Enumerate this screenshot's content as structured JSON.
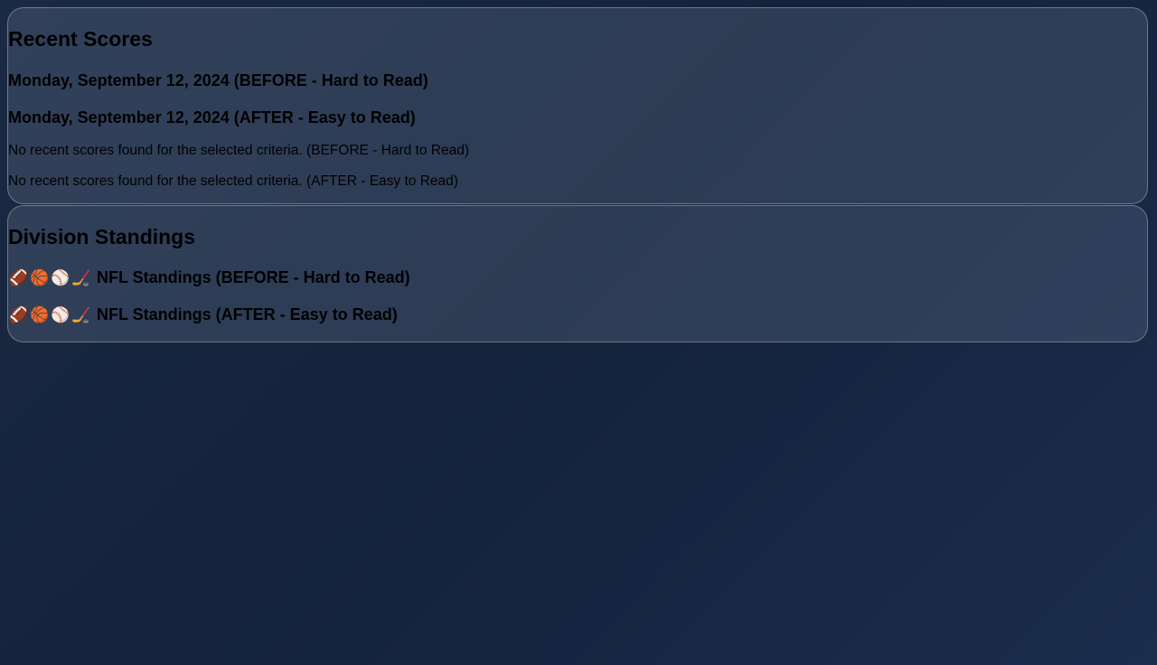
{
  "recent_scores": {
    "title": "Recent Scores",
    "date_before": "Monday, September 12, 2024 (BEFORE - Hard to Read)",
    "date_after": "Monday, September 12, 2024 (AFTER - Easy to Read)",
    "empty_before": "No recent scores found for the selected criteria. (BEFORE - Hard to Read)",
    "empty_after": "No recent scores found for the selected criteria. (AFTER - Easy to Read)"
  },
  "division_standings": {
    "title": "Division Standings",
    "icons": [
      "football-icon",
      "basketball-icon",
      "baseball-icon",
      "hockey-stick-icon"
    ],
    "nfl_before": "NFL Standings (BEFORE - Hard to Read)",
    "nfl_after": "NFL Standings (AFTER - Easy to Read)"
  }
}
